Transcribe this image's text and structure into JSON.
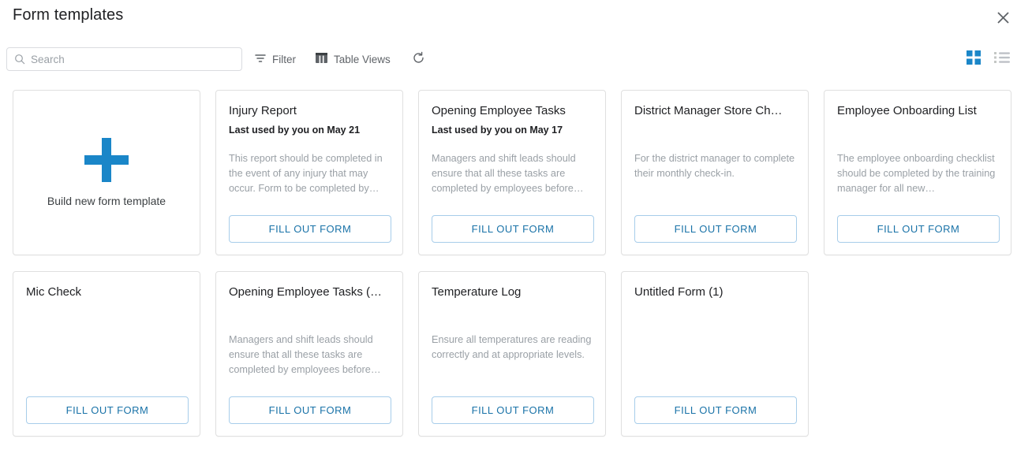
{
  "header": {
    "title": "Form templates",
    "close_icon": "close-icon"
  },
  "toolbar": {
    "search": {
      "value": "",
      "placeholder": "Search",
      "icon": "search-icon"
    },
    "filter_label": "Filter",
    "filter_icon": "filter-icon",
    "table_views_label": "Table Views",
    "table_views_icon": "table-columns-icon",
    "refresh_icon": "refresh-icon",
    "grid_view_icon": "grid-view-icon",
    "list_view_icon": "list-view-icon",
    "active_view": "grid"
  },
  "colors": {
    "accent_blue": "#1a86c8",
    "button_blue": "#1a73a8",
    "button_border": "#a7cdea",
    "card_border": "#e0e0e0",
    "title_text": "#202124",
    "muted_text": "#9aa0a6"
  },
  "new_template_card": {
    "label": "Build new form template",
    "icon": "plus-icon"
  },
  "fill_out_label": "FILL OUT FORM",
  "cards": [
    {
      "title": "Injury Report",
      "last_used": "Last used by you on May 21",
      "description": "This report should be completed in the event of any injury that may occur. Form to be completed by…"
    },
    {
      "title": "Opening Employee Tasks",
      "last_used": "Last used by you on May 17",
      "description": "Managers and shift leads should ensure that all these tasks are completed by employees before…"
    },
    {
      "title": "District Manager Store Ch…",
      "last_used": "",
      "description": "For the district manager to complete their monthly check-in."
    },
    {
      "title": "Employee Onboarding List",
      "last_used": "",
      "description": "The employee onboarding checklist should be completed by the training manager for all new…"
    },
    {
      "title": "Mic Check",
      "last_used": "",
      "description": ""
    },
    {
      "title": "Opening Employee Tasks (…",
      "last_used": "",
      "description": "Managers and shift leads should ensure that all these tasks are completed by employees before…"
    },
    {
      "title": "Temperature Log",
      "last_used": "",
      "description": "Ensure all temperatures are reading correctly and at appropriate levels."
    },
    {
      "title": "Untitled Form (1)",
      "last_used": "",
      "description": ""
    }
  ]
}
